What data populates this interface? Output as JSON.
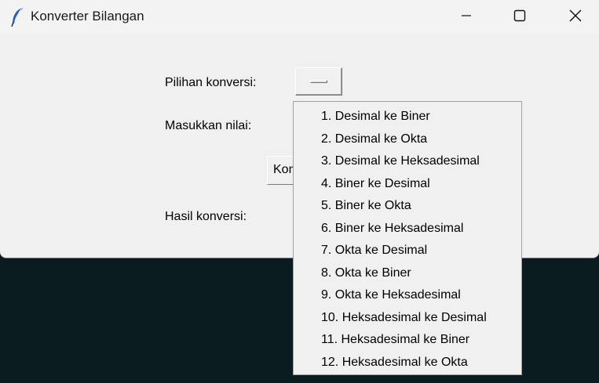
{
  "window": {
    "title": "Konverter Bilangan",
    "app_icon": "feather-icon",
    "controls": [
      "minimize-icon",
      "maximize-icon",
      "close-icon"
    ]
  },
  "form": {
    "pilihan_label": "Pilihan konversi:",
    "nilai_label": "Masukkan nilai:",
    "convert_button_label": "Konversi",
    "hasil_label": "Hasil konversi:"
  },
  "menu": {
    "items": [
      "1. Desimal ke Biner",
      "2. Desimal ke Okta",
      "3. Desimal ke Heksadesimal",
      "4. Biner ke Desimal",
      "5. Biner ke Okta",
      "6. Biner ke Heksadesimal",
      "7. Okta ke Desimal",
      "8. Okta ke Biner",
      "9. Okta ke Heksadesimal",
      "10. Heksadesimal ke Desimal",
      "11. Heksadesimal ke Biner",
      "12. Heksadesimal ke Okta"
    ]
  }
}
